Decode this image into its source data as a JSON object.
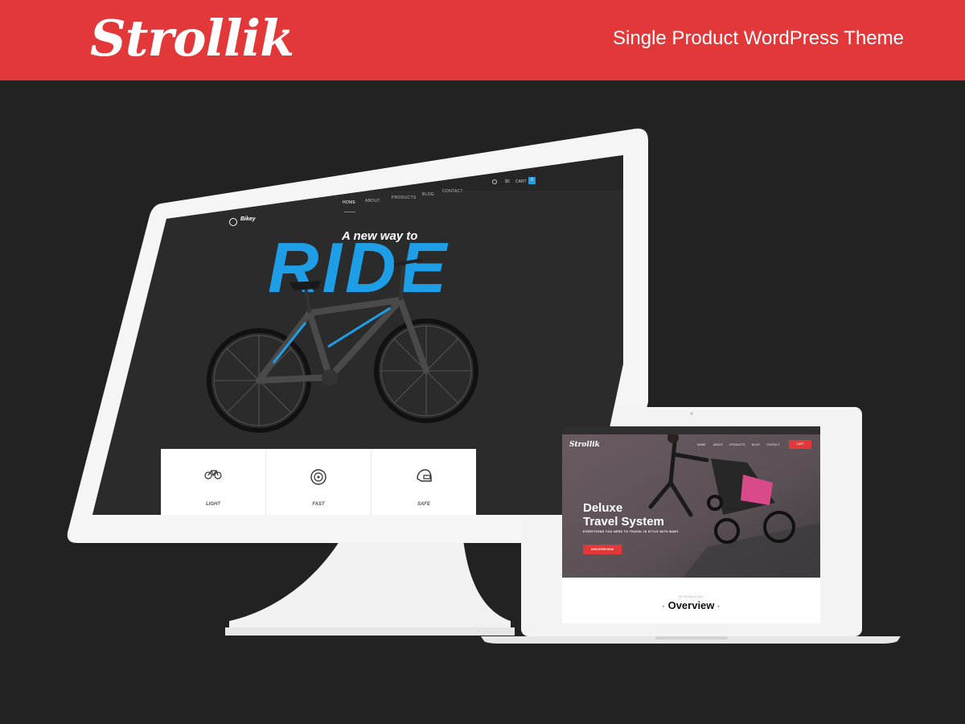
{
  "banner": {
    "brand": "Strollik",
    "tagline": "Single Product WordPress Theme"
  },
  "desktop_site": {
    "logo": "Bikey",
    "menu": [
      "HOME",
      "ABOUT",
      "PRODUCTS",
      "BLOG",
      "CONTACT"
    ],
    "active_menu": "HOME",
    "cart_price": "$0",
    "cart_label": "CART",
    "cart_count": "0",
    "hero_kicker": "A new way to",
    "hero_headline": "RIDE",
    "features": [
      {
        "icon": "bicycle-icon",
        "label": "LIGHT"
      },
      {
        "icon": "wheel-icon",
        "label": "FAST"
      },
      {
        "icon": "helmet-icon",
        "label": "SAFE"
      }
    ]
  },
  "laptop_site": {
    "logo": "Strollik",
    "menu": [
      "HOME",
      "ABOUT",
      "PRODUCTS",
      "BLOG",
      "CONTACT"
    ],
    "cart_label": "CART",
    "hero_title_line1": "Deluxe",
    "hero_title_line2": "Travel System",
    "hero_subtitle": "EVERYTHING YOU NEED TO TRAVEL IN STYLE WITH BABY",
    "cta_label": "DISCOVER NOW",
    "intro_label": "INTRODUCING",
    "section_title": "Overview"
  },
  "colors": {
    "brand_red": "#e2383a",
    "accent_blue": "#1e9ee6",
    "page_bg": "#222222"
  }
}
